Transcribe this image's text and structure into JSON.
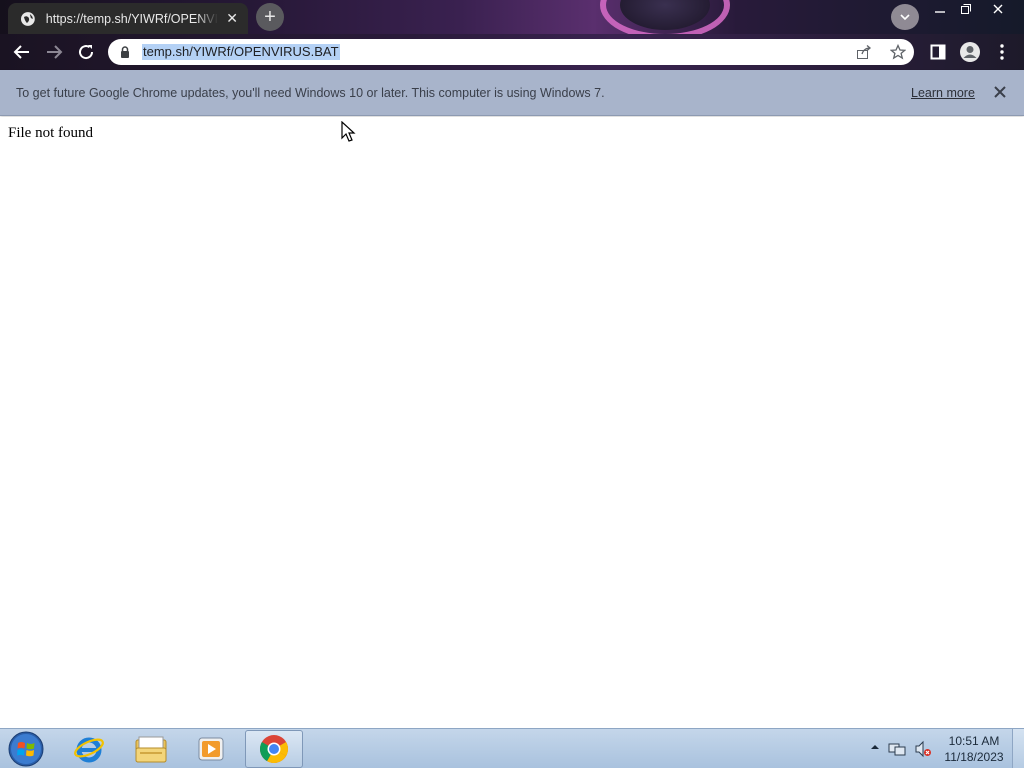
{
  "browser": {
    "tab": {
      "title": "https://temp.sh/YIWRf/OPENVIRUS.BAT",
      "favicon": "globe-icon"
    },
    "address": {
      "url": "temp.sh/YIWRf/OPENVIRUS.BAT"
    }
  },
  "infobar": {
    "message": "To get future Google Chrome updates, you'll need Windows 10 or later. This computer is using Windows 7.",
    "link": "Learn more"
  },
  "page": {
    "body_text": "File not found"
  },
  "taskbar": {
    "apps": [
      "internet-explorer-icon",
      "windows-explorer-icon",
      "media-player-icon",
      "chrome-icon"
    ],
    "clock": {
      "time": "10:51 AM",
      "date": "11/18/2023"
    }
  },
  "colors": {
    "infobar": "#a8b4cb",
    "url_selection": "#b4d1f5",
    "taskbar": "#b8cde4"
  }
}
